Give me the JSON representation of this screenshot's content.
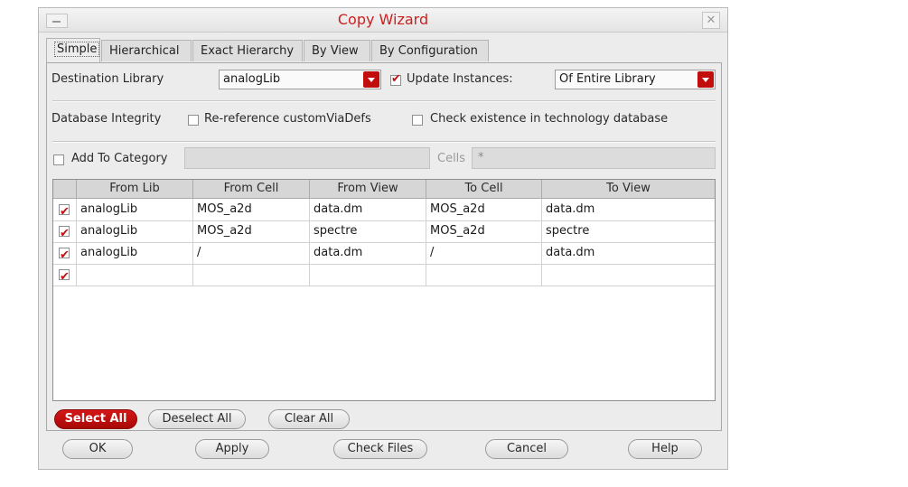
{
  "window": {
    "title": "Copy Wizard"
  },
  "tabs": [
    "Simple",
    "Hierarchical",
    "Exact Hierarchy",
    "By View",
    "By Configuration"
  ],
  "form": {
    "destination_label": "Destination Library",
    "destination_value": "analogLib",
    "update_label": "Update Instances:",
    "update_checked": true,
    "update_scope": "Of Entire Library",
    "integrity_label": "Database Integrity",
    "rereference_label": "Re-reference customViaDefs",
    "check_existence_label": "Check existence in technology database",
    "add_category_label": "Add To Category",
    "cells_label": "Cells",
    "cells_value": "*"
  },
  "table": {
    "headers": [
      "From Lib",
      "From Cell",
      "From View",
      "To Cell",
      "To View"
    ],
    "rows": [
      [
        "analogLib",
        "MOS_a2d",
        "data.dm",
        "MOS_a2d",
        "data.dm"
      ],
      [
        "analogLib",
        "MOS_a2d",
        "spectre",
        "MOS_a2d",
        "spectre"
      ],
      [
        "analogLib",
        "/",
        "data.dm",
        "/",
        "data.dm"
      ],
      [
        "",
        "",
        "",
        "",
        ""
      ]
    ]
  },
  "selection_buttons": {
    "select_all": "Select All",
    "deselect_all": "Deselect All",
    "clear_all": "Clear All"
  },
  "footer_buttons": {
    "ok": "OK",
    "apply": "Apply",
    "check_files": "Check Files",
    "cancel": "Cancel",
    "help": "Help"
  },
  "colors": {
    "accent": "#c20d0d",
    "title": "#cc1f1f"
  }
}
